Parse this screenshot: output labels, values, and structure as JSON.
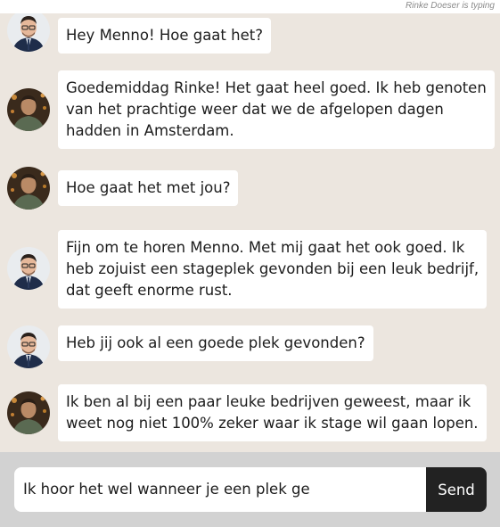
{
  "status": {
    "typing_text": "Rinke Doeser is typing"
  },
  "messages": [
    {
      "sender": "menno",
      "avatar": "avatar-menno",
      "text": "Hey Menno! Hoe gaat het?"
    },
    {
      "sender": "rinke",
      "avatar": "avatar-rinke",
      "text": "Goedemiddag Rinke! Het gaat heel goed. Ik heb genoten\nvan het prachtige weer dat we de afgelopen dagen\nhadden in Amsterdam."
    },
    {
      "sender": "rinke",
      "avatar": "avatar-rinke",
      "text": "Hoe gaat het met jou?"
    },
    {
      "sender": "menno",
      "avatar": "avatar-menno",
      "text": "Fijn om te horen Menno. Met mij gaat het ook goed. Ik\nheb zojuist een stageplek gevonden bij een leuk bedrijf,\ndat geeft enorme rust."
    },
    {
      "sender": "menno",
      "avatar": "avatar-menno",
      "text": "Heb jij ook al een goede plek gevonden?"
    },
    {
      "sender": "rinke",
      "avatar": "avatar-rinke",
      "text": "Ik ben al bij een paar leuke bedrijven geweest, maar ik\nweet nog niet 100% zeker waar ik stage wil gaan lopen."
    }
  ],
  "composer": {
    "input_value": "Ik hoor het wel wanneer je een plek ge",
    "send_label": "Send"
  },
  "colors": {
    "background": "#ece6df",
    "composer_bg": "#d2d2d2",
    "send_button": "#222222",
    "bubble": "#ffffff"
  }
}
